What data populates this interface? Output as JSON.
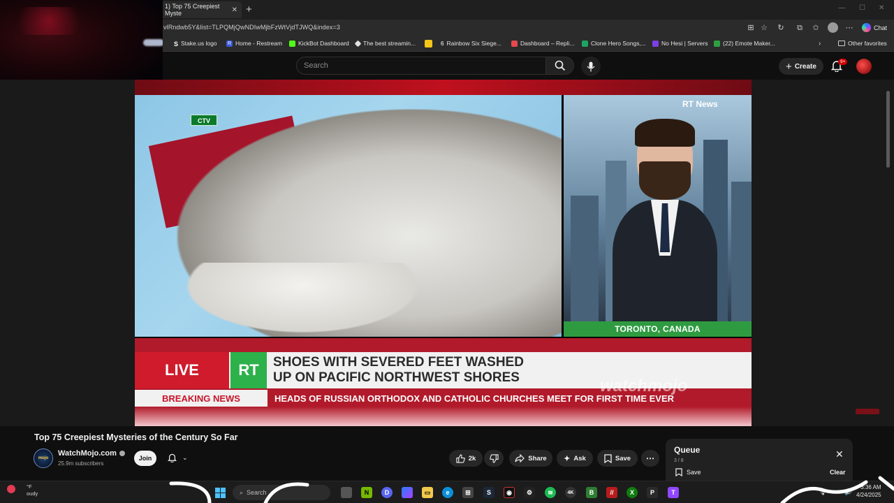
{
  "browser": {
    "tab_title": "1) Top 75 Creepiest Myste",
    "tab_close": "✕",
    "new_tab": "+",
    "url": "vlRndwb5Y&list=TLPQMjQwNDIwMjbFzWtVjdTJWQ&index=3",
    "chat_label": "Chat",
    "bookmarks": [
      {
        "label": "Stake.us logo",
        "color": "#1a1a1a",
        "glyph": "S"
      },
      {
        "label": "Home - Restream",
        "color": "#3b5bd9",
        "glyph": "R"
      },
      {
        "label": "KickBot Dashboard",
        "color": "#53fc18",
        "glyph": ""
      },
      {
        "label": "The best streamin...",
        "color": "#e0e0e0",
        "glyph": ""
      },
      {
        "label": "",
        "color": "#f5c518",
        "glyph": ""
      },
      {
        "label": "Rainbow Six Siege...",
        "color": "#2a2a2a",
        "glyph": "6"
      },
      {
        "label": "Dashboard – Repli...",
        "color": "#e5484d",
        "glyph": ""
      },
      {
        "label": "Clone Hero Songs,...",
        "color": "#1ea362",
        "glyph": ""
      },
      {
        "label": "No Hesi | Servers",
        "color": "#7b3fe4",
        "glyph": ""
      },
      {
        "label": "(22) Emote Maker...",
        "color": "#2ea043",
        "glyph": ""
      }
    ],
    "other_favorites": "Other favorites"
  },
  "youtube": {
    "search_placeholder": "Search",
    "create_label": "Create",
    "notif_badge": "9+"
  },
  "video": {
    "network_badge": "CTV",
    "channel_bug": "RT News",
    "location": "TORONTO, CANADA",
    "live": "LIVE",
    "rt_logo": "RT",
    "headline_line1": "SHOES WITH SEVERED FEET WASHED",
    "headline_line2": "UP ON PACIFIC NORTHWEST SHORES",
    "breaking_label": "BREAKING NEWS",
    "ticker": "HEADS OF RUSSIAN ORTHODOX AND CATHOLIC CHURCHES MEET FOR FIRST TIME EVER",
    "watermark": "watchmojo"
  },
  "meta": {
    "title": "Top 75 Creepiest Mysteries of the Century So Far",
    "channel_name": "WatchMojo.com",
    "avatar_text": "mojo",
    "subscribers": "25.9m subscribers",
    "join": "Join",
    "likes": "2k",
    "share": "Share",
    "ask": "Ask",
    "save": "Save",
    "more": "⋯"
  },
  "queue": {
    "title": "Queue",
    "count": "3 / 8",
    "save": "Save",
    "clear": "Clear"
  },
  "taskbar": {
    "weather_temp": "°F",
    "weather_desc": "oudy",
    "search": "Search",
    "time": "3:36 AM",
    "date": "4/24/2025"
  }
}
